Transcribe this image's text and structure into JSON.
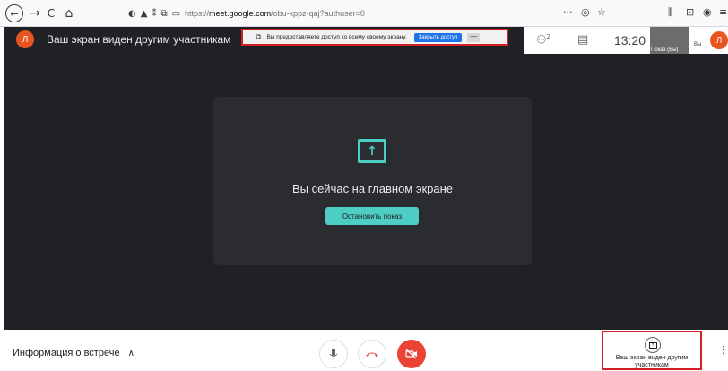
{
  "browser": {
    "back_icon": "←",
    "forward_icon": "→",
    "reload_icon": "C",
    "home_icon": "⌂",
    "url_scheme": "https://",
    "url_host": "meet.google.com",
    "url_path": "/obu-kppz-qaj?authuser=0",
    "more_label": "···",
    "pocket_icon": "◎",
    "star_icon": "☆",
    "library_icon": "⫼",
    "sidebar_icon": "⊡",
    "account_icon": "◉",
    "menu_icon": "≡"
  },
  "meet": {
    "avatar_letter": "Л",
    "share_title": "Ваш экран виден другим участникам",
    "notice": {
      "text": "Вы предоставляете доступ ко всему своему экрану.",
      "close_button": "Закрыть доступ",
      "minimize": "—"
    },
    "top_right": {
      "people_count": "2",
      "time": "13:20",
      "thumb_label": "Показ (Вы)",
      "you_label": "Вы",
      "avatar_letter": "Л"
    },
    "card": {
      "message": "Вы сейчас на главном экране",
      "stop_button": "Остановить показ"
    }
  },
  "bottom": {
    "meeting_info": "Информация о встрече",
    "present_label": "Ваш экран виден другим участникам",
    "colors": {
      "hangup": "#ea4335",
      "accent": "#4ecdc4",
      "highlight": "#d32027"
    }
  }
}
